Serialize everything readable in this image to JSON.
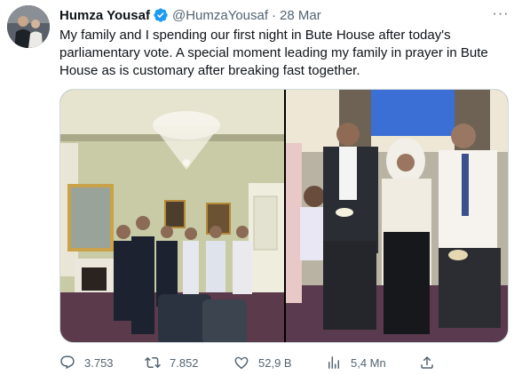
{
  "tweet": {
    "author_name": "Humza Yousaf",
    "handle": "@HumzaYousaf",
    "separator": "·",
    "date": "28 Mar",
    "text": "My family and I spending our first night in Bute House after today's parliamentary vote. A special moment leading my family in prayer in Bute House as is customary after breaking fast together.",
    "more_label": "···"
  },
  "metrics": {
    "replies": "3.753",
    "retweets": "7.852",
    "likes": "52,9 B",
    "views": "5,4 Mn"
  },
  "icons": {
    "verified": "verified-badge-icon",
    "reply": "reply-icon",
    "retweet": "retweet-icon",
    "like": "heart-icon",
    "views": "views-icon",
    "share": "share-icon",
    "more": "more-icon"
  },
  "colors": {
    "verified": "#1d9bf0",
    "secondary_text": "#536471",
    "primary_text": "#0f1419"
  }
}
